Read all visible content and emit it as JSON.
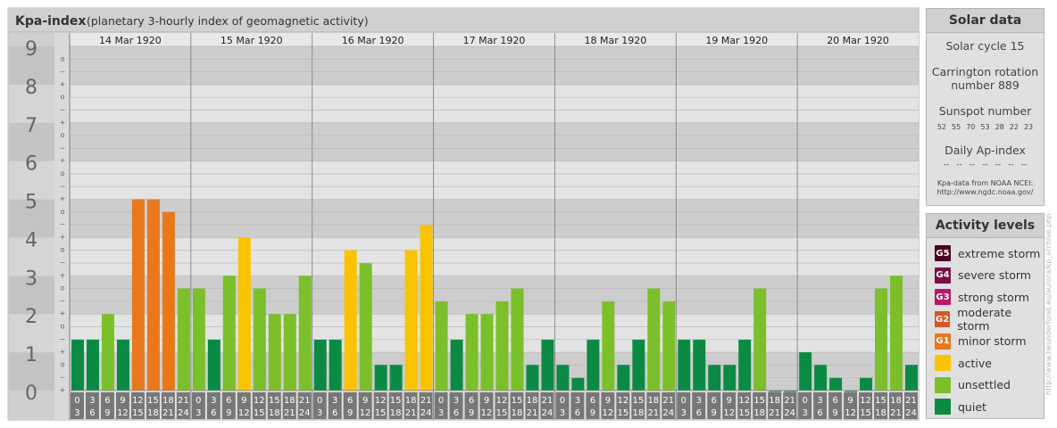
{
  "header": {
    "title": "Kpa-index",
    "subtitle": "(planetary 3-hourly index of geomagnetic activity)"
  },
  "colors": {
    "quiet": "#0b8a44",
    "unsettled": "#7bbf2a",
    "active": "#f9c300",
    "minor_storm": "#e8781a",
    "moderate_storm": "#d95523",
    "strong_storm": "#b8176b",
    "severe_storm": "#7b0f45",
    "extreme_storm": "#4a0020",
    "zebra_dark": "#cdcdcd",
    "zebra_light": "#e3e3e3",
    "panel": "#e0e0e0",
    "tick_box": "#777777"
  },
  "chart_data": {
    "type": "bar",
    "ylim": [
      0,
      9
    ],
    "y_tick_labels": [
      "0",
      "1",
      "2",
      "3",
      "4",
      "5",
      "6",
      "7",
      "8",
      "9"
    ],
    "sub_tick_labels": [
      "+",
      "−",
      "o"
    ],
    "days": [
      "14 Mar 1920",
      "15 Mar 1920",
      "16 Mar 1920",
      "17 Mar 1920",
      "18 Mar 1920",
      "19 Mar 1920",
      "20 Mar 1920"
    ],
    "interval_labels": [
      [
        "0",
        "3"
      ],
      [
        "3",
        "6"
      ],
      [
        "6",
        "9"
      ],
      [
        "9",
        "12"
      ],
      [
        "12",
        "15"
      ],
      [
        "15",
        "18"
      ],
      [
        "18",
        "21"
      ],
      [
        "21",
        "24"
      ]
    ],
    "values": [
      [
        1.33,
        1.33,
        2.0,
        1.33,
        5.0,
        5.0,
        4.67,
        2.67
      ],
      [
        2.67,
        1.33,
        3.0,
        4.0,
        2.67,
        2.0,
        2.0,
        3.0
      ],
      [
        1.33,
        1.33,
        3.67,
        3.33,
        0.67,
        0.67,
        3.67,
        4.33
      ],
      [
        2.33,
        1.33,
        2.0,
        2.0,
        2.33,
        2.67,
        0.67,
        1.33
      ],
      [
        0.67,
        0.33,
        1.33,
        2.33,
        0.67,
        1.33,
        2.67,
        2.33
      ],
      [
        1.33,
        1.33,
        0.67,
        0.67,
        1.33,
        2.67,
        0.0,
        0.0
      ],
      [
        1.0,
        0.67,
        0.33,
        0.0,
        0.33,
        2.67,
        3.0,
        0.67
      ]
    ]
  },
  "solar": {
    "title": "Solar data",
    "cycle": "Solar cycle 15",
    "carrington_1": "Carrington rotation",
    "carrington_2": "number 889",
    "sunspot_label": "Sunspot number",
    "sunspots": [
      "52",
      "55",
      "70",
      "53",
      "28",
      "22",
      "23"
    ],
    "ap_label": "Daily Ap-index",
    "ap_values": [
      "--",
      "--",
      "--",
      "--",
      "--",
      "--",
      "--"
    ],
    "credit_1": "Kpa-data from NOAA NCEI:",
    "credit_2": "http://www.ngdc.noaa.gov/"
  },
  "activity": {
    "title": "Activity levels",
    "levels": [
      {
        "code": "G5",
        "label": "extreme storm",
        "color": "#4a0020"
      },
      {
        "code": "G4",
        "label": "severe storm",
        "color": "#7b0f45"
      },
      {
        "code": "G3",
        "label": "strong storm",
        "color": "#b8176b"
      },
      {
        "code": "G2",
        "label": "moderate storm",
        "color": "#d95523"
      },
      {
        "code": "G1",
        "label": "minor storm",
        "color": "#e8781a"
      },
      {
        "code": "",
        "label": "active",
        "color": "#f9c300"
      },
      {
        "code": "",
        "label": "unsettled",
        "color": "#7bbf2a"
      },
      {
        "code": "",
        "label": "quiet",
        "color": "#0b8a44"
      }
    ]
  },
  "watermark": "http://www.tieunderforet.eu/aurora/kp_archive.php"
}
